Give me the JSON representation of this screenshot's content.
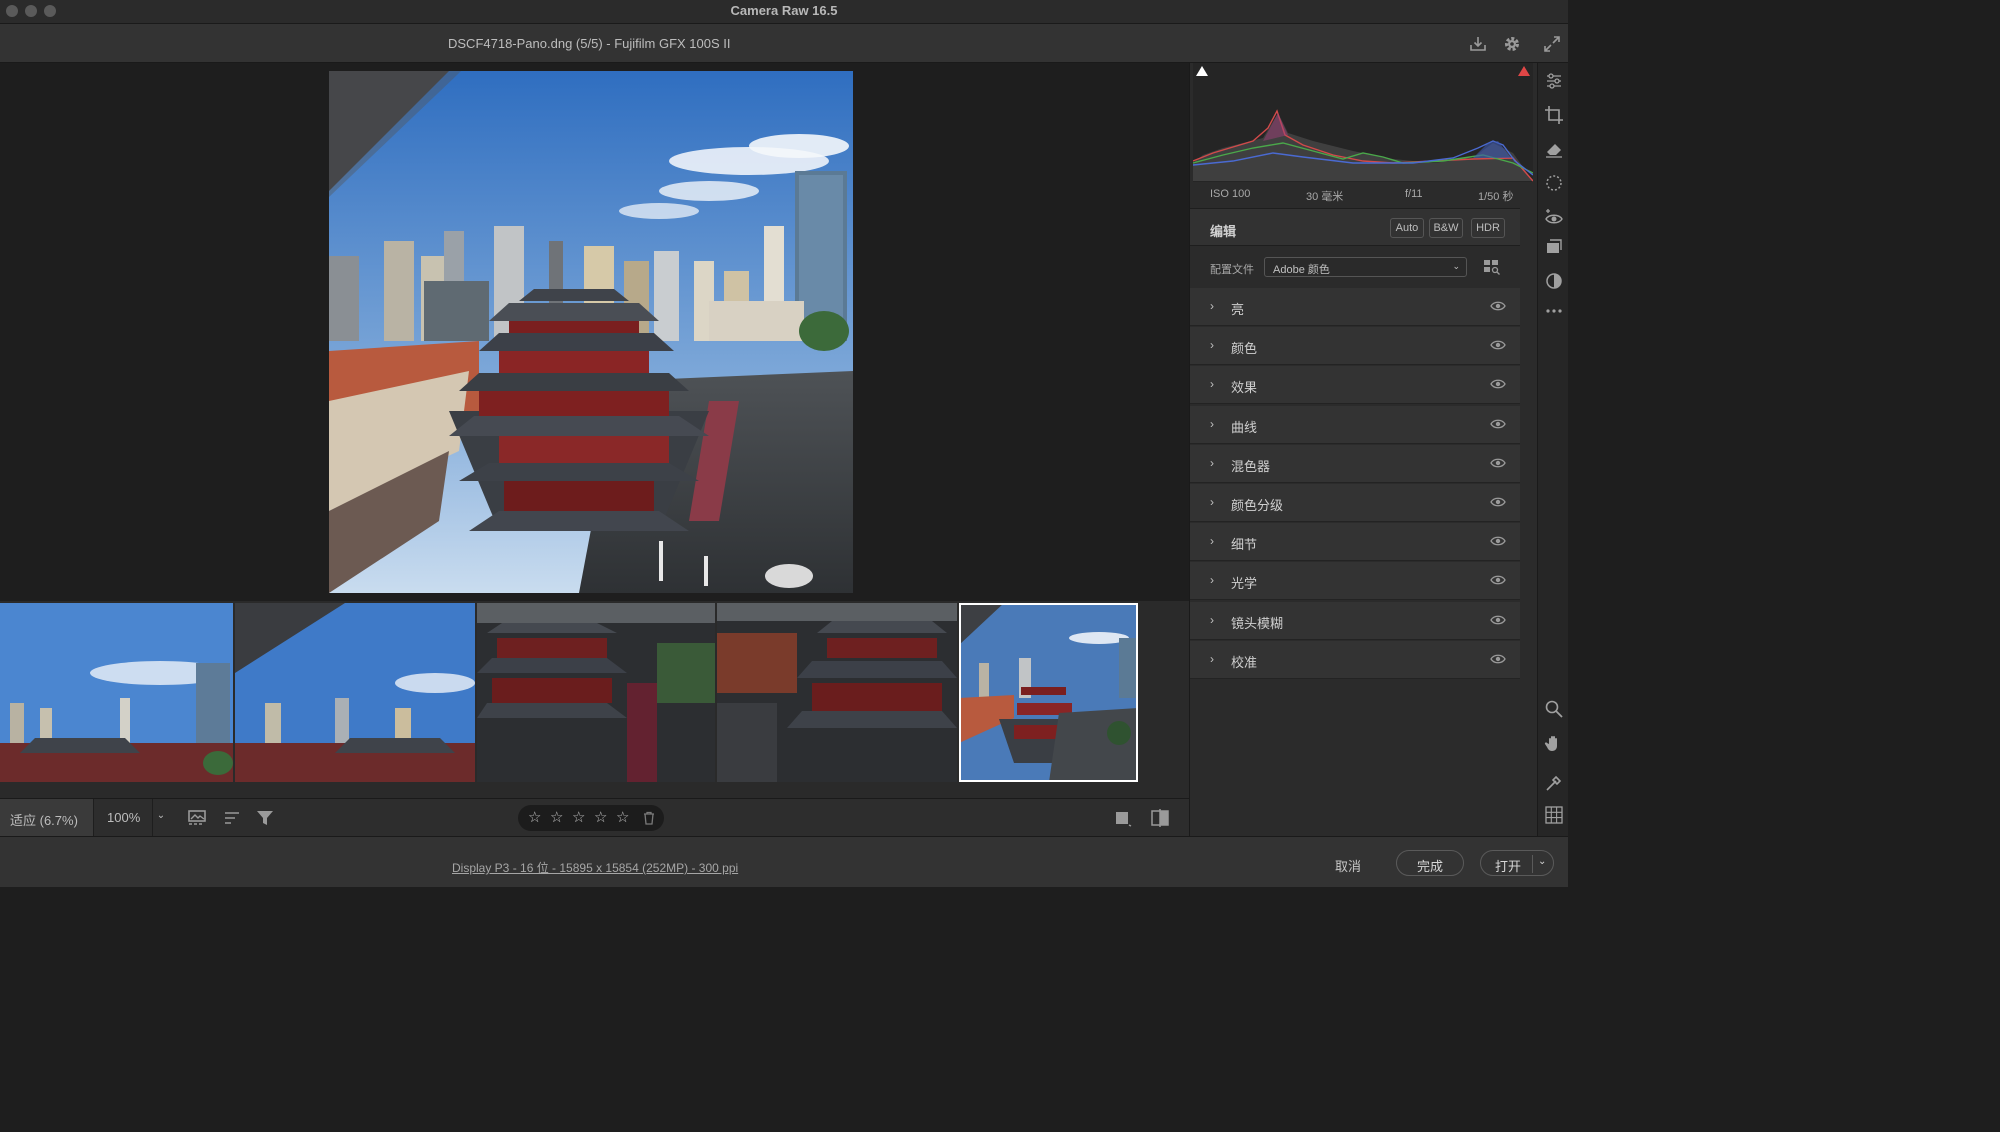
{
  "window": {
    "title": "Camera Raw 16.5"
  },
  "header": {
    "file_title": "DSCF4718-Pano.dng (5/5) -  Fujifilm GFX 100S II"
  },
  "exif": {
    "iso": "ISO 100",
    "focal": "30 毫米",
    "aperture": "f/11",
    "shutter": "1/50 秒"
  },
  "edit": {
    "title": "编辑",
    "auto_label": "Auto",
    "bw_label": "B&W",
    "hdr_label": "HDR",
    "profile_label": "配置文件",
    "profile_value": "Adobe 颜色"
  },
  "sections": [
    "亮",
    "颜色",
    "效果",
    "曲线",
    "混色器",
    "颜色分级",
    "细节",
    "光学",
    "镜头模糊",
    "校准"
  ],
  "bottombar": {
    "zoom_fit": "适应 (6.7%)",
    "zoom_value": "100%"
  },
  "status": {
    "display_info": "Display P3 - 16 位 - 15895 x 15854 (252MP) - 300 ppi",
    "cancel": "取消",
    "done": "完成",
    "open": "打开"
  },
  "filmstrip": {
    "count": 5,
    "selected_index": 4
  },
  "icons": {
    "header": [
      "save-icon",
      "settings-gear-icon",
      "fullscreen-icon"
    ],
    "right_toolbar": [
      "edit-sliders-icon",
      "crop-icon",
      "eraser-icon",
      "mask-icon",
      "redeye-icon",
      "snapshots-icon",
      "presets-icon",
      "more-icon",
      "zoom-icon",
      "hand-icon",
      "color-sampler-icon",
      "grid-overlay-icon"
    ]
  },
  "colors": {
    "panel": "#333333",
    "background": "#1e1e1e",
    "clip_warning": "#e04646"
  }
}
